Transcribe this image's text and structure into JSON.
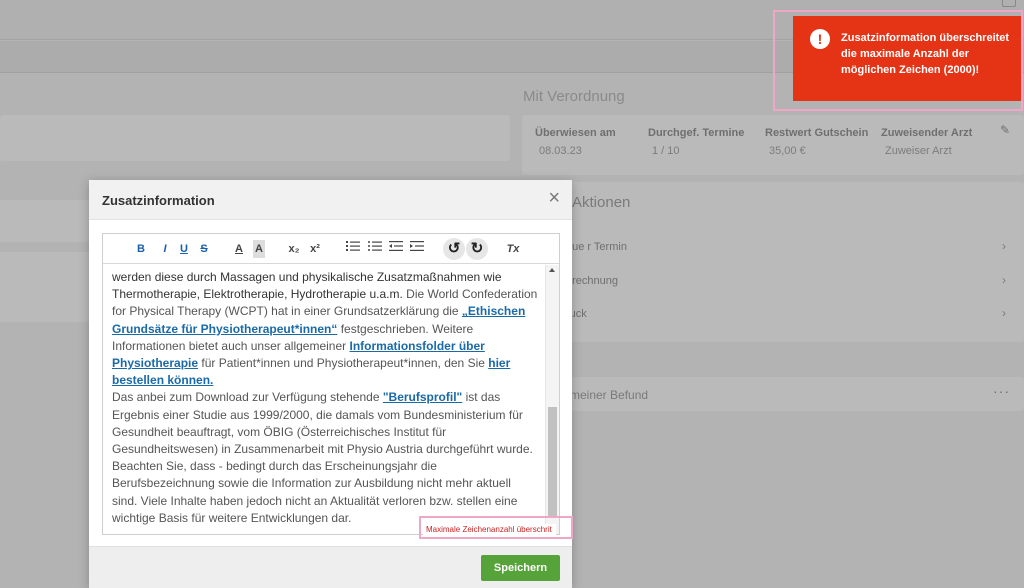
{
  "background": {
    "section_title": "Mit Verordnung",
    "card": {
      "columns": [
        {
          "header": "Überwiesen am",
          "value": "08.03.23"
        },
        {
          "header": "Durchgef. Termine",
          "value": "1 / 10"
        },
        {
          "header": "Restwert Gutschein",
          "value": "35,00 €"
        },
        {
          "header": "Zuweisender Arzt",
          "value": "Zuweiser Arzt"
        }
      ]
    },
    "actions": {
      "title": "Aktionen",
      "items": [
        "eue r Termin",
        "brechnung",
        "ruck"
      ]
    },
    "befund_label": "meiner Befund"
  },
  "modal": {
    "title": "Zusatzinformation",
    "close_glyph": "×",
    "toolbar": {
      "bold": "B",
      "italic": "I",
      "underline": "U",
      "strike": "S",
      "text_color": "A",
      "bg_color": "A",
      "subscript": "x₂",
      "superscript": "x²",
      "undo": "↺",
      "redo": "↻",
      "clear_format": "Tx"
    },
    "content": {
      "p1_dark": "werden diese durch Massagen und physikalische Zusatzmaßnahmen wie Thermotherapie, Elektrotherapie, Hydrotherapie u.a.m.",
      "p1_tail": " Die World Confederation for Physical Therapy (WCPT) hat in einer Grundsatzerklärung die ",
      "link_ethics": "„Ethischen Grundsätze für Physiotherapeut*innen“",
      "p1_end": " festgeschrieben. Weitere Informationen bietet auch unser allgemeiner ",
      "link_folder": "Informationsfolder über Physiotherapie",
      "p2_mid": " für Patient*innen und Physiotherapeut*innen, den Sie ",
      "link_order": "hier bestellen können.",
      "p3_start": "Das anbei zum Download zur Verfügung stehende ",
      "link_profile": "\"Berufsprofil\"",
      "p3_rest": " ist das Ergebnis einer Studie aus 1999/2000, die damals vom Bundesministerium für Gesundheit beauftragt, vom ÖBIG (Österreichisches Institut für Gesundheitswesen) in Zusammenarbeit mit Physio Austria durchgeführt wurde. Beachten Sie, dass - bedingt durch das Erscheinungsjahr die Berufsbezeichnung sowie die Information zur Ausbildung nicht mehr aktuell sind. Viele Inhalte haben jedoch nicht an Aktualität verloren bzw. stellen eine wichtige Basis für weitere Entwicklungen dar."
    },
    "limit_message": "Maximale Zeichenanzahl überschrit",
    "save_label": "Speichern"
  },
  "toast": {
    "icon": "!",
    "message": "Zusatzinformation überschreitet die maximale Anzahl der möglichen Zeichen (2000)!"
  },
  "colors": {
    "accent_save": "#56a33a",
    "toast_bg": "#e53315",
    "highlight": "#f0a6c6",
    "link": "#1a6aa8"
  }
}
